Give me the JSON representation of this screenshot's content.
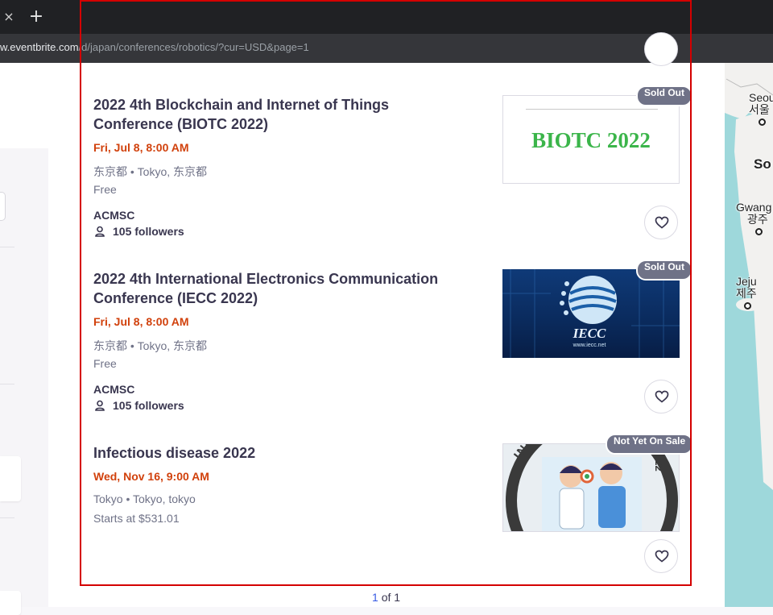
{
  "browser": {
    "url_host": "w.eventbrite.com",
    "url_path": "/d/japan/conferences/robotics/?cur=USD&page=1",
    "tab_close_glyph": "×",
    "new_tab_glyph": "+"
  },
  "events": [
    {
      "title": "2022 4th Blockchain and Internet of Things Conference (BIOTC 2022)",
      "date": "Fri, Jul 8, 8:00 AM",
      "location": "东京都 • Tokyo, 东京都",
      "price": "Free",
      "organizer": "ACMSC",
      "followers": "105 followers",
      "badge": "Sold Out",
      "image_text": "BIOTC 2022"
    },
    {
      "title": "2022 4th International Electronics Communication Conference (IECC 2022)",
      "date": "Fri, Jul 8, 8:00 AM",
      "location": "东京都 • Tokyo, 东京都",
      "price": "Free",
      "organizer": "ACMSC",
      "followers": "105 followers",
      "badge": "Sold Out",
      "image_text": "IECC",
      "image_subtext": "www.iecc.net"
    },
    {
      "title": "Infectious disease 2022",
      "date": "Wed, Nov 16, 9:00 AM",
      "location": "Tokyo • Tokyo, tokyo",
      "price": "Starts at $531.01",
      "badge": "Not Yet On Sale",
      "image_text": "INFEC",
      "image_year": "022"
    }
  ],
  "pagination": {
    "current": "1",
    "of": "of",
    "total": "1"
  },
  "map": {
    "cities": [
      {
        "name": "Seoul",
        "native": "서울"
      },
      {
        "name": "So"
      },
      {
        "name": "Gwang",
        "native": "광주"
      },
      {
        "name": "Jeju",
        "native": "제주"
      }
    ]
  },
  "colors": {
    "accent_date": "#d1410c",
    "badge": "#6f7287",
    "highlight_border": "#d40000",
    "page_link": "#3659e3"
  }
}
